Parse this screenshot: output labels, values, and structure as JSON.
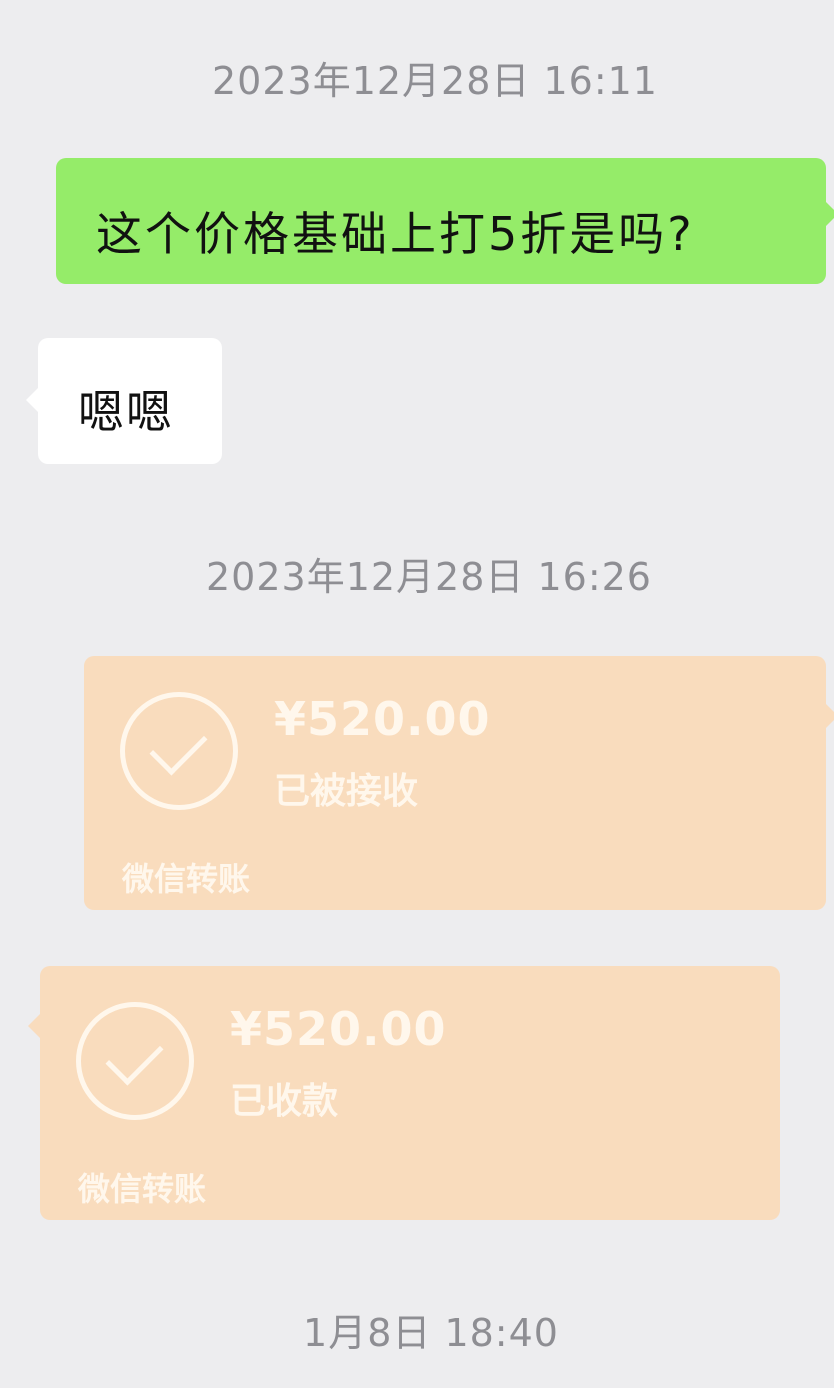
{
  "chat": {
    "timestamps": [
      "2023年12月28日 16:11",
      "2023年12月28日 16:26",
      "1月8日 18:40"
    ],
    "messages": {
      "outgoing_text": "这个价格基础上打5折是吗?",
      "incoming_text": "嗯嗯"
    },
    "transfers": [
      {
        "amount": "¥520.00",
        "status": "已被接收",
        "label": "微信转账"
      },
      {
        "amount": "¥520.00",
        "status": "已收款",
        "label": "微信转账"
      }
    ]
  },
  "colors": {
    "background": "#EDEDEF",
    "outgoing_bubble": "#95EC69",
    "incoming_bubble": "#FFFFFF",
    "transfer_card": "#F9DCBD",
    "timestamp_text": "#8E8E93"
  },
  "icons": {
    "transfer_status": "check-circle-icon"
  }
}
